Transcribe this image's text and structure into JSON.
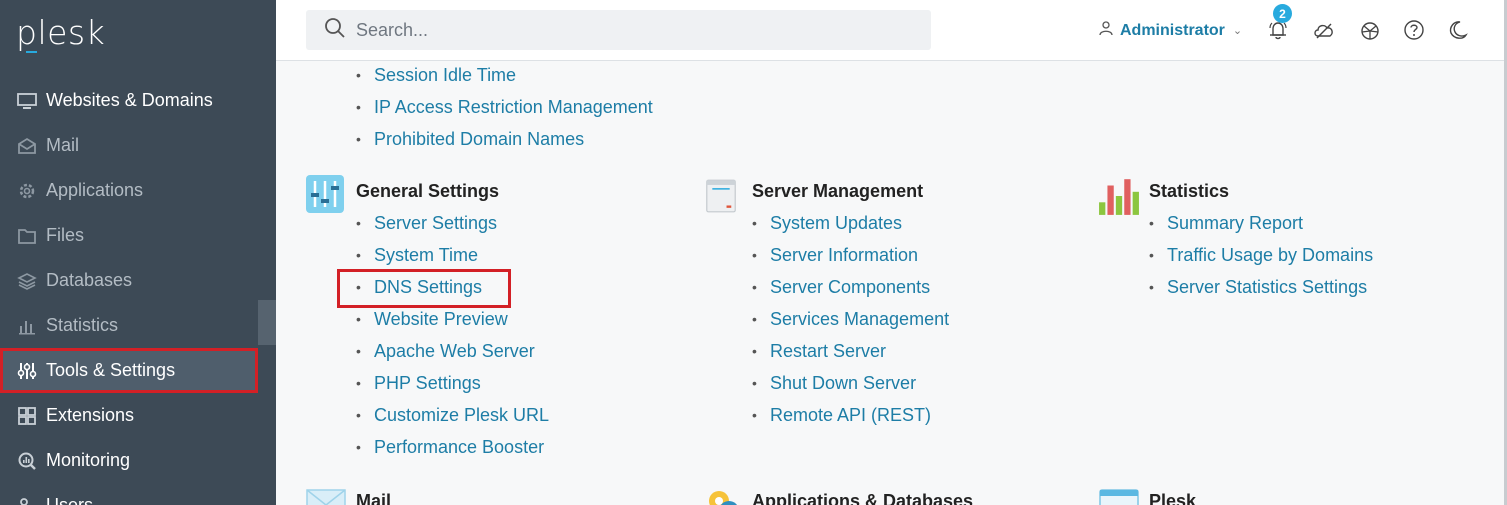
{
  "sidebar": {
    "logo": "plesk",
    "items": [
      {
        "label": "Websites & Domains",
        "icon": "monitor-icon"
      },
      {
        "label": "Mail",
        "icon": "mail-icon"
      },
      {
        "label": "Applications",
        "icon": "gear-icon"
      },
      {
        "label": "Files",
        "icon": "folder-icon"
      },
      {
        "label": "Databases",
        "icon": "database-icon"
      },
      {
        "label": "Statistics",
        "icon": "bar-chart-icon"
      },
      {
        "label": "Tools & Settings",
        "icon": "sliders-icon"
      },
      {
        "label": "Extensions",
        "icon": "puzzle-icon"
      },
      {
        "label": "Monitoring",
        "icon": "monitoring-icon"
      },
      {
        "label": "Users",
        "icon": "users-icon"
      }
    ]
  },
  "header": {
    "search_placeholder": "Search...",
    "user": "Administrator",
    "notifications_count": "2"
  },
  "content": {
    "top_links": [
      "Session Idle Time",
      "IP Access Restriction Management",
      "Prohibited Domain Names"
    ],
    "sections": [
      {
        "title": "General Settings",
        "links": [
          "Server Settings",
          "System Time",
          "DNS Settings",
          "Website Preview",
          "Apache Web Server",
          "PHP Settings",
          "Customize Plesk URL",
          "Performance Booster"
        ]
      },
      {
        "title": "Server Management",
        "links": [
          "System Updates",
          "Server Information",
          "Server Components",
          "Services Management",
          "Restart Server",
          "Shut Down Server",
          "Remote API (REST)"
        ]
      },
      {
        "title": "Statistics",
        "links": [
          "Summary Report",
          "Traffic Usage by Domains",
          "Server Statistics Settings"
        ]
      },
      {
        "title": "Mail"
      },
      {
        "title": "Applications & Databases"
      },
      {
        "title": "Plesk"
      }
    ]
  },
  "colors": {
    "sidebar_bg": "#3d4a56",
    "link": "#1d7da6",
    "accent": "#28aade",
    "highlight": "#d32026"
  }
}
